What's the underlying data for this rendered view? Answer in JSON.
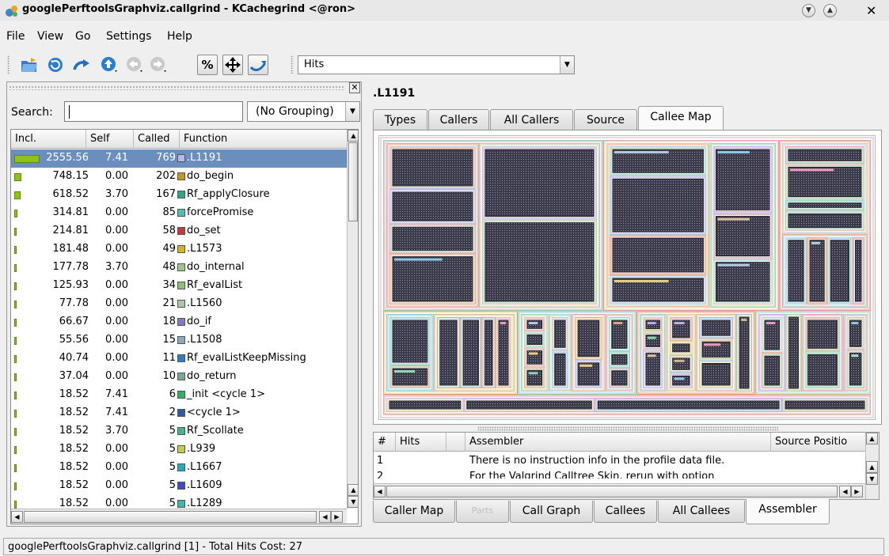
{
  "window": {
    "title": "googlePerftoolsGraphviz.callgrind - KCachegrind <@ron>"
  },
  "menu": {
    "file": "File",
    "view": "View",
    "go": "Go",
    "settings": "Settings",
    "help": "Help"
  },
  "toolbar": {
    "event_type": "Hits"
  },
  "left_panel": {
    "search_label": "Search:",
    "search_value": "",
    "grouping": "(No Grouping)",
    "columns": {
      "incl": "Incl.",
      "self": "Self",
      "called": "Called",
      "function": "Function"
    },
    "rows": [
      {
        "incl": "2555.56",
        "self": "7.41",
        "called": "769",
        "fn": ".L1191",
        "color": "#b8b8e8",
        "bar": 1.0
      },
      {
        "incl": "748.15",
        "self": "0.00",
        "called": "202",
        "fn": "do_begin",
        "color": "#c79a16",
        "bar": 0.29
      },
      {
        "incl": "618.52",
        "self": "3.70",
        "called": "167",
        "fn": "Rf_applyClosure",
        "color": "#2ca58a",
        "bar": 0.24
      },
      {
        "incl": "314.81",
        "self": "0.00",
        "called": "85",
        "fn": "forcePromise",
        "color": "#4cc2b4",
        "bar": 0.123
      },
      {
        "incl": "214.81",
        "self": "0.00",
        "called": "58",
        "fn": "do_set",
        "color": "#c8393e",
        "bar": 0.084
      },
      {
        "incl": "181.48",
        "self": "0.00",
        "called": "49",
        "fn": ".L1573",
        "color": "#d8b414",
        "bar": 0.071
      },
      {
        "incl": "177.78",
        "self": "3.70",
        "called": "48",
        "fn": "do_internal",
        "color": "#9bc68a",
        "bar": 0.069
      },
      {
        "incl": "125.93",
        "self": "0.00",
        "called": "34",
        "fn": "Rf_evalList",
        "color": "#8dc070",
        "bar": 0.049
      },
      {
        "incl": "77.78",
        "self": "0.00",
        "called": "21",
        "fn": ".L1560",
        "color": "#a8c8a8",
        "bar": 0.03
      },
      {
        "incl": "66.67",
        "self": "0.00",
        "called": "18",
        "fn": "do_if",
        "color": "#7a7ac8",
        "bar": 0.026
      },
      {
        "incl": "55.56",
        "self": "0.00",
        "called": "15",
        "fn": ".L1508",
        "color": "#8aa8c8",
        "bar": 0.022
      },
      {
        "incl": "40.74",
        "self": "0.00",
        "called": "11",
        "fn": "Rf_evalListKeepMissing",
        "color": "#2a7ec8",
        "bar": 0.016
      },
      {
        "incl": "37.04",
        "self": "0.00",
        "called": "10",
        "fn": "do_return",
        "color": "#7aa890",
        "bar": 0.014
      },
      {
        "incl": "18.52",
        "self": "7.41",
        "called": "6",
        "fn": "_init <cycle 1>",
        "color": "#2ab060",
        "bar": 0.007
      },
      {
        "incl": "18.52",
        "self": "7.41",
        "called": "2",
        "fn": "<cycle 1>",
        "color": "#2a5aa8",
        "bar": 0.007
      },
      {
        "incl": "18.52",
        "self": "3.70",
        "called": "5",
        "fn": "Rf_Scollate",
        "color": "#3ab890",
        "bar": 0.007
      },
      {
        "incl": "18.52",
        "self": "0.00",
        "called": "5",
        "fn": ".L939",
        "color": "#c8c84a",
        "bar": 0.007
      },
      {
        "incl": "18.52",
        "self": "0.00",
        "called": "5",
        "fn": ".L1667",
        "color": "#2aa8b8",
        "bar": 0.007
      },
      {
        "incl": "18.52",
        "self": "0.00",
        "called": "5",
        "fn": ".L1609",
        "color": "#3a4ac8",
        "bar": 0.007
      },
      {
        "incl": "18.52",
        "self": "0.00",
        "called": "5",
        "fn": ".L1289",
        "color": "#3ab8a8",
        "bar": 0.007
      }
    ]
  },
  "right_panel": {
    "title": ".L1191",
    "top_tabs": [
      "Types",
      "Callers",
      "All Callers",
      "Source",
      "Callee Map"
    ],
    "asm_columns": {
      "num": "#",
      "hits": "Hits",
      "assembler": "Assembler",
      "source": "Source Positio"
    },
    "asm_rows": [
      {
        "num": "1",
        "text": "There is no instruction info in the profile data file."
      },
      {
        "num": "2",
        "text": "For the Valgrind Calltree Skin, rerun with option"
      }
    ],
    "bottom_tabs": [
      "Caller Map",
      "Parts",
      "Call Graph",
      "Callees",
      "All Callees",
      "Assembler"
    ]
  },
  "status": {
    "text": "googlePerftoolsGraphviz.callgrind [1] - Total Hits Cost: 27"
  }
}
